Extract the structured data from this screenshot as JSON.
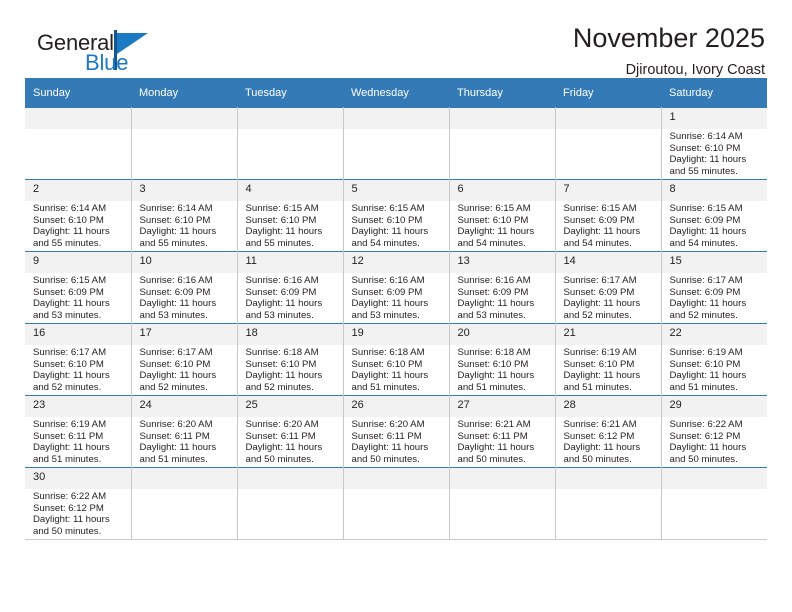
{
  "brand": {
    "name_part1": "General",
    "name_part2": "Blue",
    "flag_icon": "flag-icon"
  },
  "header": {
    "title": "November 2025",
    "subtitle": "Djiroutou, Ivory Coast"
  },
  "colors": {
    "header_blue": "#337ab7",
    "brand_blue": "#1b7ac4",
    "daynum_bg": "#f2f2f2",
    "grid_line": "#c8c8c8",
    "text": "#231f20"
  },
  "weekdays": [
    "Sunday",
    "Monday",
    "Tuesday",
    "Wednesday",
    "Thursday",
    "Friday",
    "Saturday"
  ],
  "weeks": [
    [
      {
        "day": "",
        "lines": []
      },
      {
        "day": "",
        "lines": []
      },
      {
        "day": "",
        "lines": []
      },
      {
        "day": "",
        "lines": []
      },
      {
        "day": "",
        "lines": []
      },
      {
        "day": "",
        "lines": []
      },
      {
        "day": "1",
        "lines": [
          "Sunrise: 6:14 AM",
          "Sunset: 6:10 PM",
          "Daylight: 11 hours",
          "and 55 minutes."
        ]
      }
    ],
    [
      {
        "day": "2",
        "lines": [
          "Sunrise: 6:14 AM",
          "Sunset: 6:10 PM",
          "Daylight: 11 hours",
          "and 55 minutes."
        ]
      },
      {
        "day": "3",
        "lines": [
          "Sunrise: 6:14 AM",
          "Sunset: 6:10 PM",
          "Daylight: 11 hours",
          "and 55 minutes."
        ]
      },
      {
        "day": "4",
        "lines": [
          "Sunrise: 6:15 AM",
          "Sunset: 6:10 PM",
          "Daylight: 11 hours",
          "and 55 minutes."
        ]
      },
      {
        "day": "5",
        "lines": [
          "Sunrise: 6:15 AM",
          "Sunset: 6:10 PM",
          "Daylight: 11 hours",
          "and 54 minutes."
        ]
      },
      {
        "day": "6",
        "lines": [
          "Sunrise: 6:15 AM",
          "Sunset: 6:10 PM",
          "Daylight: 11 hours",
          "and 54 minutes."
        ]
      },
      {
        "day": "7",
        "lines": [
          "Sunrise: 6:15 AM",
          "Sunset: 6:09 PM",
          "Daylight: 11 hours",
          "and 54 minutes."
        ]
      },
      {
        "day": "8",
        "lines": [
          "Sunrise: 6:15 AM",
          "Sunset: 6:09 PM",
          "Daylight: 11 hours",
          "and 54 minutes."
        ]
      }
    ],
    [
      {
        "day": "9",
        "lines": [
          "Sunrise: 6:15 AM",
          "Sunset: 6:09 PM",
          "Daylight: 11 hours",
          "and 53 minutes."
        ]
      },
      {
        "day": "10",
        "lines": [
          "Sunrise: 6:16 AM",
          "Sunset: 6:09 PM",
          "Daylight: 11 hours",
          "and 53 minutes."
        ]
      },
      {
        "day": "11",
        "lines": [
          "Sunrise: 6:16 AM",
          "Sunset: 6:09 PM",
          "Daylight: 11 hours",
          "and 53 minutes."
        ]
      },
      {
        "day": "12",
        "lines": [
          "Sunrise: 6:16 AM",
          "Sunset: 6:09 PM",
          "Daylight: 11 hours",
          "and 53 minutes."
        ]
      },
      {
        "day": "13",
        "lines": [
          "Sunrise: 6:16 AM",
          "Sunset: 6:09 PM",
          "Daylight: 11 hours",
          "and 53 minutes."
        ]
      },
      {
        "day": "14",
        "lines": [
          "Sunrise: 6:17 AM",
          "Sunset: 6:09 PM",
          "Daylight: 11 hours",
          "and 52 minutes."
        ]
      },
      {
        "day": "15",
        "lines": [
          "Sunrise: 6:17 AM",
          "Sunset: 6:09 PM",
          "Daylight: 11 hours",
          "and 52 minutes."
        ]
      }
    ],
    [
      {
        "day": "16",
        "lines": [
          "Sunrise: 6:17 AM",
          "Sunset: 6:10 PM",
          "Daylight: 11 hours",
          "and 52 minutes."
        ]
      },
      {
        "day": "17",
        "lines": [
          "Sunrise: 6:17 AM",
          "Sunset: 6:10 PM",
          "Daylight: 11 hours",
          "and 52 minutes."
        ]
      },
      {
        "day": "18",
        "lines": [
          "Sunrise: 6:18 AM",
          "Sunset: 6:10 PM",
          "Daylight: 11 hours",
          "and 52 minutes."
        ]
      },
      {
        "day": "19",
        "lines": [
          "Sunrise: 6:18 AM",
          "Sunset: 6:10 PM",
          "Daylight: 11 hours",
          "and 51 minutes."
        ]
      },
      {
        "day": "20",
        "lines": [
          "Sunrise: 6:18 AM",
          "Sunset: 6:10 PM",
          "Daylight: 11 hours",
          "and 51 minutes."
        ]
      },
      {
        "day": "21",
        "lines": [
          "Sunrise: 6:19 AM",
          "Sunset: 6:10 PM",
          "Daylight: 11 hours",
          "and 51 minutes."
        ]
      },
      {
        "day": "22",
        "lines": [
          "Sunrise: 6:19 AM",
          "Sunset: 6:10 PM",
          "Daylight: 11 hours",
          "and 51 minutes."
        ]
      }
    ],
    [
      {
        "day": "23",
        "lines": [
          "Sunrise: 6:19 AM",
          "Sunset: 6:11 PM",
          "Daylight: 11 hours",
          "and 51 minutes."
        ]
      },
      {
        "day": "24",
        "lines": [
          "Sunrise: 6:20 AM",
          "Sunset: 6:11 PM",
          "Daylight: 11 hours",
          "and 51 minutes."
        ]
      },
      {
        "day": "25",
        "lines": [
          "Sunrise: 6:20 AM",
          "Sunset: 6:11 PM",
          "Daylight: 11 hours",
          "and 50 minutes."
        ]
      },
      {
        "day": "26",
        "lines": [
          "Sunrise: 6:20 AM",
          "Sunset: 6:11 PM",
          "Daylight: 11 hours",
          "and 50 minutes."
        ]
      },
      {
        "day": "27",
        "lines": [
          "Sunrise: 6:21 AM",
          "Sunset: 6:11 PM",
          "Daylight: 11 hours",
          "and 50 minutes."
        ]
      },
      {
        "day": "28",
        "lines": [
          "Sunrise: 6:21 AM",
          "Sunset: 6:12 PM",
          "Daylight: 11 hours",
          "and 50 minutes."
        ]
      },
      {
        "day": "29",
        "lines": [
          "Sunrise: 6:22 AM",
          "Sunset: 6:12 PM",
          "Daylight: 11 hours",
          "and 50 minutes."
        ]
      }
    ],
    [
      {
        "day": "30",
        "lines": [
          "Sunrise: 6:22 AM",
          "Sunset: 6:12 PM",
          "Daylight: 11 hours",
          "and 50 minutes."
        ]
      },
      {
        "day": "",
        "lines": []
      },
      {
        "day": "",
        "lines": []
      },
      {
        "day": "",
        "lines": []
      },
      {
        "day": "",
        "lines": []
      },
      {
        "day": "",
        "lines": []
      },
      {
        "day": "",
        "lines": []
      }
    ]
  ]
}
